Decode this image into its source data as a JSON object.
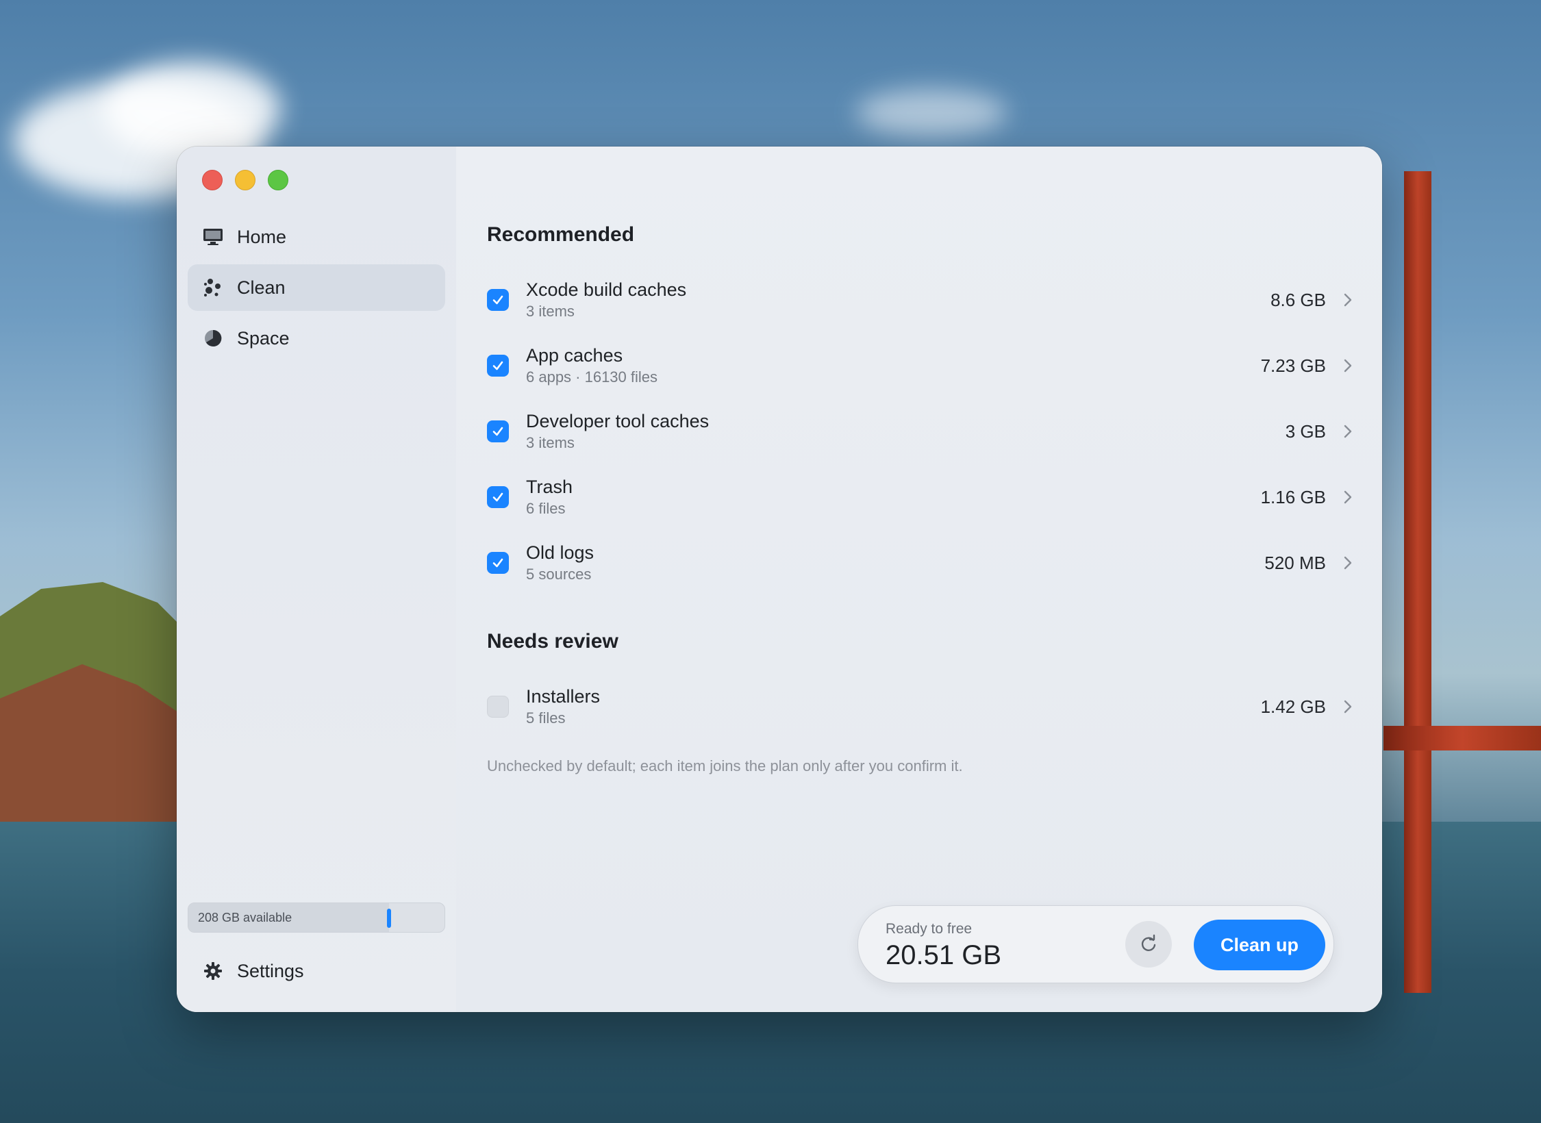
{
  "sidebar": {
    "nav": [
      {
        "label": "Home",
        "icon": "monitor-icon"
      },
      {
        "label": "Clean",
        "icon": "sparkles-icon",
        "active": true
      },
      {
        "label": "Space",
        "icon": "pie-chart-icon"
      }
    ],
    "storage": {
      "label": "208 GB available",
      "used_fraction": 0.78
    },
    "settings_label": "Settings"
  },
  "main": {
    "recommended_title": "Recommended",
    "recommended": [
      {
        "title": "Xcode build caches",
        "subtitle": "3 items",
        "size": "8.6 GB",
        "checked": true
      },
      {
        "title": "App caches",
        "subtitle": "6 apps · 16130 files",
        "size": "7.23 GB",
        "checked": true
      },
      {
        "title": "Developer tool caches",
        "subtitle": "3 items",
        "size": "3 GB",
        "checked": true
      },
      {
        "title": "Trash",
        "subtitle": "6 files",
        "size": "1.16 GB",
        "checked": true
      },
      {
        "title": "Old logs",
        "subtitle": "5 sources",
        "size": "520 MB",
        "checked": true
      }
    ],
    "review_title": "Needs review",
    "review": [
      {
        "title": "Installers",
        "subtitle": "5 files",
        "size": "1.42 GB",
        "checked": false
      }
    ],
    "note": "Unchecked by default; each item joins the plan only after you confirm it."
  },
  "footer": {
    "ready_label": "Ready to free",
    "ready_value": "20.51 GB",
    "clean_label": "Clean up"
  },
  "colors": {
    "accent": "#1a84ff"
  }
}
